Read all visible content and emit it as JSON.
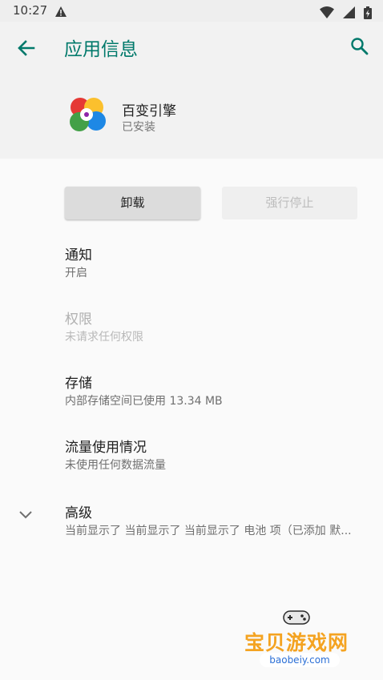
{
  "status_bar": {
    "time": "10:27"
  },
  "app_bar": {
    "title": "应用信息"
  },
  "app": {
    "name": "百变引擎",
    "status": "已安装"
  },
  "buttons": {
    "uninstall": "卸载",
    "force_stop": "强行停止"
  },
  "settings": [
    {
      "title": "通知",
      "summary": "开启",
      "enabled": true
    },
    {
      "title": "权限",
      "summary": "未请求任何权限",
      "enabled": false
    },
    {
      "title": "存储",
      "summary": "内部存储空间已使用 13.34 MB",
      "enabled": true
    },
    {
      "title": "流量使用情况",
      "summary": "未使用任何数据流量",
      "enabled": true
    },
    {
      "title": "高级",
      "summary": "当前显示了 当前显示了 当前显示了 电池 项（已添加 默...",
      "enabled": true
    }
  ],
  "watermark": {
    "text": "宝贝游戏网",
    "url": "baobeiy.com"
  },
  "colors": {
    "accent": "#00796b",
    "header_bg": "#f2f2f2",
    "page_bg": "#fafafa"
  }
}
